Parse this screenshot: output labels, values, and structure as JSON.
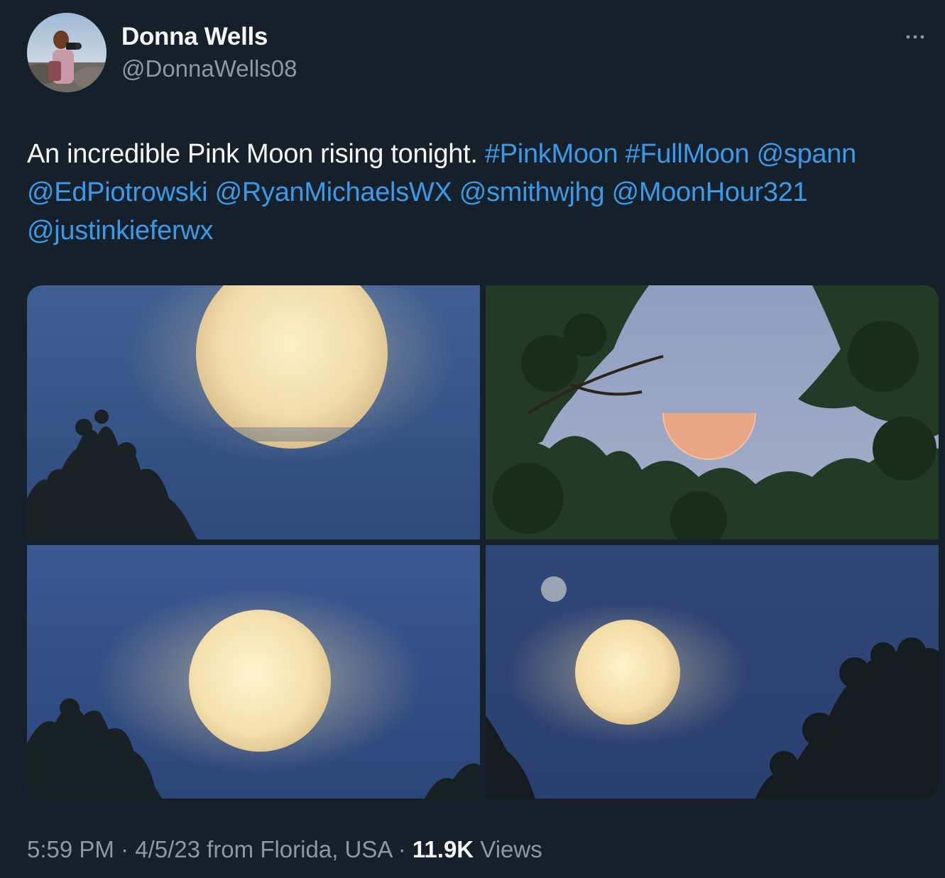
{
  "author": {
    "display_name": "Donna Wells",
    "handle": "@DonnaWells08",
    "avatar_icon": "avatar-photographer"
  },
  "more_icon": "more-horizontal-icon",
  "tweet": {
    "text_plain": "An incredible Pink Moon rising tonight.",
    "hashtags": [
      "#PinkMoon",
      "#FullMoon"
    ],
    "mentions": [
      "@spann",
      "@EdPiotrowski",
      "@RyanMichaelsWX",
      "@smithwjhg",
      "@MoonHour321",
      "@justinkieferwx"
    ]
  },
  "media": [
    {
      "description_icon": "moon-photo-1"
    },
    {
      "description_icon": "moon-photo-2"
    },
    {
      "description_icon": "moon-photo-3"
    },
    {
      "description_icon": "moon-photo-4"
    }
  ],
  "meta": {
    "time": "5:59 PM",
    "sep1": " · ",
    "date": "4/5/23",
    "location": " from Florida, USA",
    "sep2": " · ",
    "views_count": "11.9K",
    "views_label": " Views"
  },
  "colors": {
    "background": "#15202b",
    "link": "#3b9ae8",
    "secondary_text": "#8b98a5",
    "primary_text": "#f7f9f9"
  }
}
